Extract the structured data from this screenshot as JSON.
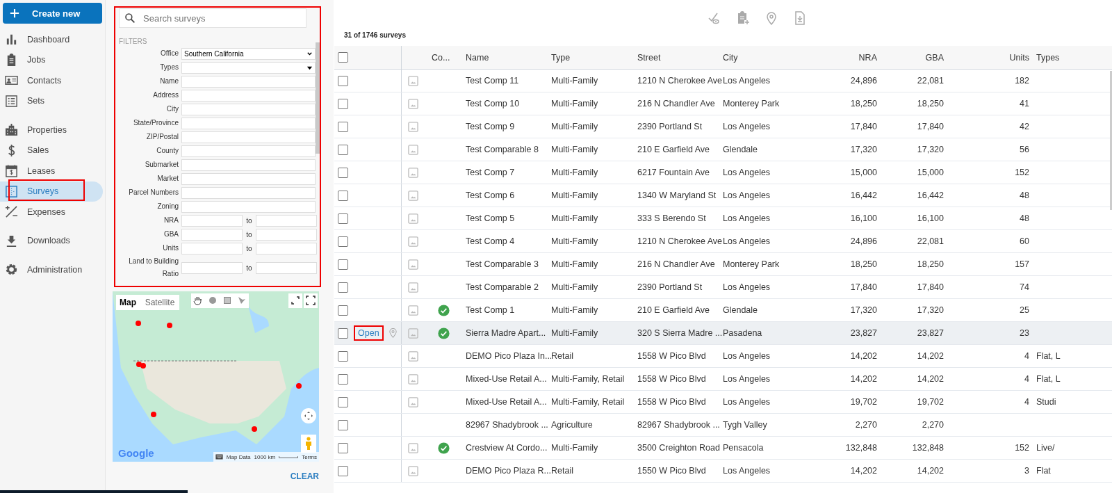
{
  "create_button": {
    "label": "Create new"
  },
  "nav": [
    {
      "label": "Dashboard",
      "selected": false,
      "annotated": false
    },
    {
      "label": "Jobs",
      "selected": false,
      "annotated": false
    },
    {
      "label": "Contacts",
      "selected": false,
      "annotated": false
    },
    {
      "label": "Sets",
      "selected": false,
      "annotated": false
    },
    {
      "label": "Properties",
      "selected": false,
      "annotated": false
    },
    {
      "label": "Sales",
      "selected": false,
      "annotated": false
    },
    {
      "label": "Leases",
      "selected": false,
      "annotated": false
    },
    {
      "label": "Surveys",
      "selected": true,
      "annotated": true
    },
    {
      "label": "Expenses",
      "selected": false,
      "annotated": false
    },
    {
      "label": "Downloads",
      "selected": false,
      "annotated": false
    },
    {
      "label": "Administration",
      "selected": false,
      "annotated": false
    }
  ],
  "filter_panel": {
    "annotated": true,
    "search": {
      "placeholder": "Search surveys"
    },
    "heading": "FILTERS",
    "fields": [
      {
        "kind": "select",
        "label": "Office",
        "value": "Southern California"
      },
      {
        "kind": "multiselect",
        "label": "Types"
      },
      {
        "kind": "text",
        "label": "Name"
      },
      {
        "kind": "text",
        "label": "Address"
      },
      {
        "kind": "text",
        "label": "City"
      },
      {
        "kind": "text",
        "label": "State/Province"
      },
      {
        "kind": "text",
        "label": "ZIP/Postal"
      },
      {
        "kind": "text",
        "label": "County"
      },
      {
        "kind": "text",
        "label": "Submarket"
      },
      {
        "kind": "text",
        "label": "Market"
      },
      {
        "kind": "text",
        "label": "Parcel Numbers"
      },
      {
        "kind": "text",
        "label": "Zoning"
      },
      {
        "kind": "range",
        "label": "NRA",
        "separator": "to"
      },
      {
        "kind": "range",
        "label": "GBA",
        "separator": "to"
      },
      {
        "kind": "range",
        "label": "Units",
        "separator": "to"
      },
      {
        "kind": "range",
        "label": "Land to Building Ratio",
        "separator": "to"
      }
    ]
  },
  "map": {
    "type_buttons": [
      {
        "label": "Map",
        "selected": true
      },
      {
        "label": "Satellite",
        "selected": false
      }
    ],
    "logo": "Google",
    "attribution": "Map Data",
    "scale": "1000 km",
    "terms": "Terms"
  },
  "clear_button": {
    "label": "CLEAR"
  },
  "result_count": "31 of 1746 surveys",
  "table": {
    "header_checked": false,
    "columns": [
      "Co...",
      "Name",
      "Type",
      "Street",
      "City",
      "NRA",
      "GBA",
      "Units",
      "Types"
    ],
    "rows": [
      {
        "checked": false,
        "hovered": false,
        "has_photo": true,
        "complete": false,
        "cells": [
          "",
          "Test Comp 11",
          "Multi-Family",
          "1210 N Cherokee Ave",
          "Los Angeles",
          "24,896",
          "22,081",
          "182",
          ""
        ]
      },
      {
        "checked": false,
        "hovered": false,
        "has_photo": true,
        "complete": false,
        "cells": [
          "",
          "Test Comp 10",
          "Multi-Family",
          "216 N Chandler Ave",
          "Monterey Park",
          "18,250",
          "18,250",
          "41",
          ""
        ]
      },
      {
        "checked": false,
        "hovered": false,
        "has_photo": true,
        "complete": false,
        "cells": [
          "",
          "Test Comp 9",
          "Multi-Family",
          "2390 Portland St",
          "Los Angeles",
          "17,840",
          "17,840",
          "42",
          ""
        ]
      },
      {
        "checked": false,
        "hovered": false,
        "has_photo": true,
        "complete": false,
        "cells": [
          "",
          "Test Comparable 8",
          "Multi-Family",
          "210 E Garfield Ave",
          "Glendale",
          "17,320",
          "17,320",
          "56",
          ""
        ]
      },
      {
        "checked": false,
        "hovered": false,
        "has_photo": true,
        "complete": false,
        "cells": [
          "",
          "Test Comp 7",
          "Multi-Family",
          "6217 Fountain Ave",
          "Los Angeles",
          "15,000",
          "15,000",
          "152",
          ""
        ]
      },
      {
        "checked": false,
        "hovered": false,
        "has_photo": true,
        "complete": false,
        "cells": [
          "",
          "Test Comp 6",
          "Multi-Family",
          "1340 W Maryland St",
          "Los Angeles",
          "16,442",
          "16,442",
          "48",
          ""
        ]
      },
      {
        "checked": false,
        "hovered": false,
        "has_photo": true,
        "complete": false,
        "cells": [
          "",
          "Test Comp 5",
          "Multi-Family",
          "333 S Berendo St",
          "Los Angeles",
          "16,100",
          "16,100",
          "48",
          ""
        ]
      },
      {
        "checked": false,
        "hovered": false,
        "has_photo": true,
        "complete": false,
        "cells": [
          "",
          "Test Comp 4",
          "Multi-Family",
          "1210 N Cherokee Ave",
          "Los Angeles",
          "24,896",
          "22,081",
          "60",
          ""
        ]
      },
      {
        "checked": false,
        "hovered": false,
        "has_photo": true,
        "complete": false,
        "cells": [
          "",
          "Test Comparable 3",
          "Multi-Family",
          "216 N Chandler Ave",
          "Monterey Park",
          "18,250",
          "18,250",
          "157",
          ""
        ]
      },
      {
        "checked": false,
        "hovered": false,
        "has_photo": true,
        "complete": false,
        "cells": [
          "",
          "Test Comparable 2",
          "Multi-Family",
          "2390 Portland St",
          "Los Angeles",
          "17,840",
          "17,840",
          "74",
          ""
        ]
      },
      {
        "checked": false,
        "hovered": false,
        "has_photo": true,
        "complete": true,
        "cells": [
          "",
          "Test Comp 1",
          "Multi-Family",
          "210 E Garfield Ave",
          "Glendale",
          "17,320",
          "17,320",
          "25",
          ""
        ]
      },
      {
        "checked": false,
        "hovered": true,
        "action": "Open",
        "action_annotated": true,
        "has_photo": true,
        "complete": true,
        "cells": [
          "",
          "Sierra Madre Apart...",
          "Multi-Family",
          "320 S Sierra Madre ...",
          "Pasadena",
          "23,827",
          "23,827",
          "23",
          ""
        ]
      },
      {
        "checked": false,
        "hovered": false,
        "has_photo": true,
        "complete": false,
        "cells": [
          "",
          "DEMO Pico Plaza In...",
          "Retail",
          "1558 W Pico Blvd",
          "Los Angeles",
          "14,202",
          "14,202",
          "4",
          "Flat, L"
        ]
      },
      {
        "checked": false,
        "hovered": false,
        "has_photo": true,
        "complete": false,
        "cells": [
          "",
          "Mixed-Use Retail A...",
          "Multi-Family, Retail",
          "1558 W Pico Blvd",
          "Los Angeles",
          "14,202",
          "14,202",
          "4",
          "Flat, L"
        ]
      },
      {
        "checked": false,
        "hovered": false,
        "has_photo": true,
        "complete": false,
        "cells": [
          "",
          "Mixed-Use Retail A...",
          "Multi-Family, Retail",
          "1558 W Pico Blvd",
          "Los Angeles",
          "19,702",
          "19,702",
          "4",
          "Studi"
        ]
      },
      {
        "checked": false,
        "hovered": false,
        "has_photo": false,
        "complete": false,
        "cells": [
          "",
          "82967 Shadybrook ...",
          "Agriculture",
          "82967 Shadybrook ...",
          "Tygh Valley",
          "2,270",
          "2,270",
          "",
          ""
        ]
      },
      {
        "checked": false,
        "hovered": false,
        "has_photo": true,
        "complete": true,
        "cells": [
          "",
          "Crestview At Cordo...",
          "Multi-Family",
          "3500 Creighton Road",
          "Pensacola",
          "132,848",
          "132,848",
          "152",
          "Live/"
        ]
      },
      {
        "checked": false,
        "hovered": false,
        "has_photo": true,
        "complete": false,
        "cells": [
          "",
          "DEMO Pico Plaza R...",
          "Retail",
          "1550 W Pico Blvd",
          "Los Angeles",
          "14,202",
          "14,202",
          "3",
          "Flat"
        ]
      }
    ]
  }
}
